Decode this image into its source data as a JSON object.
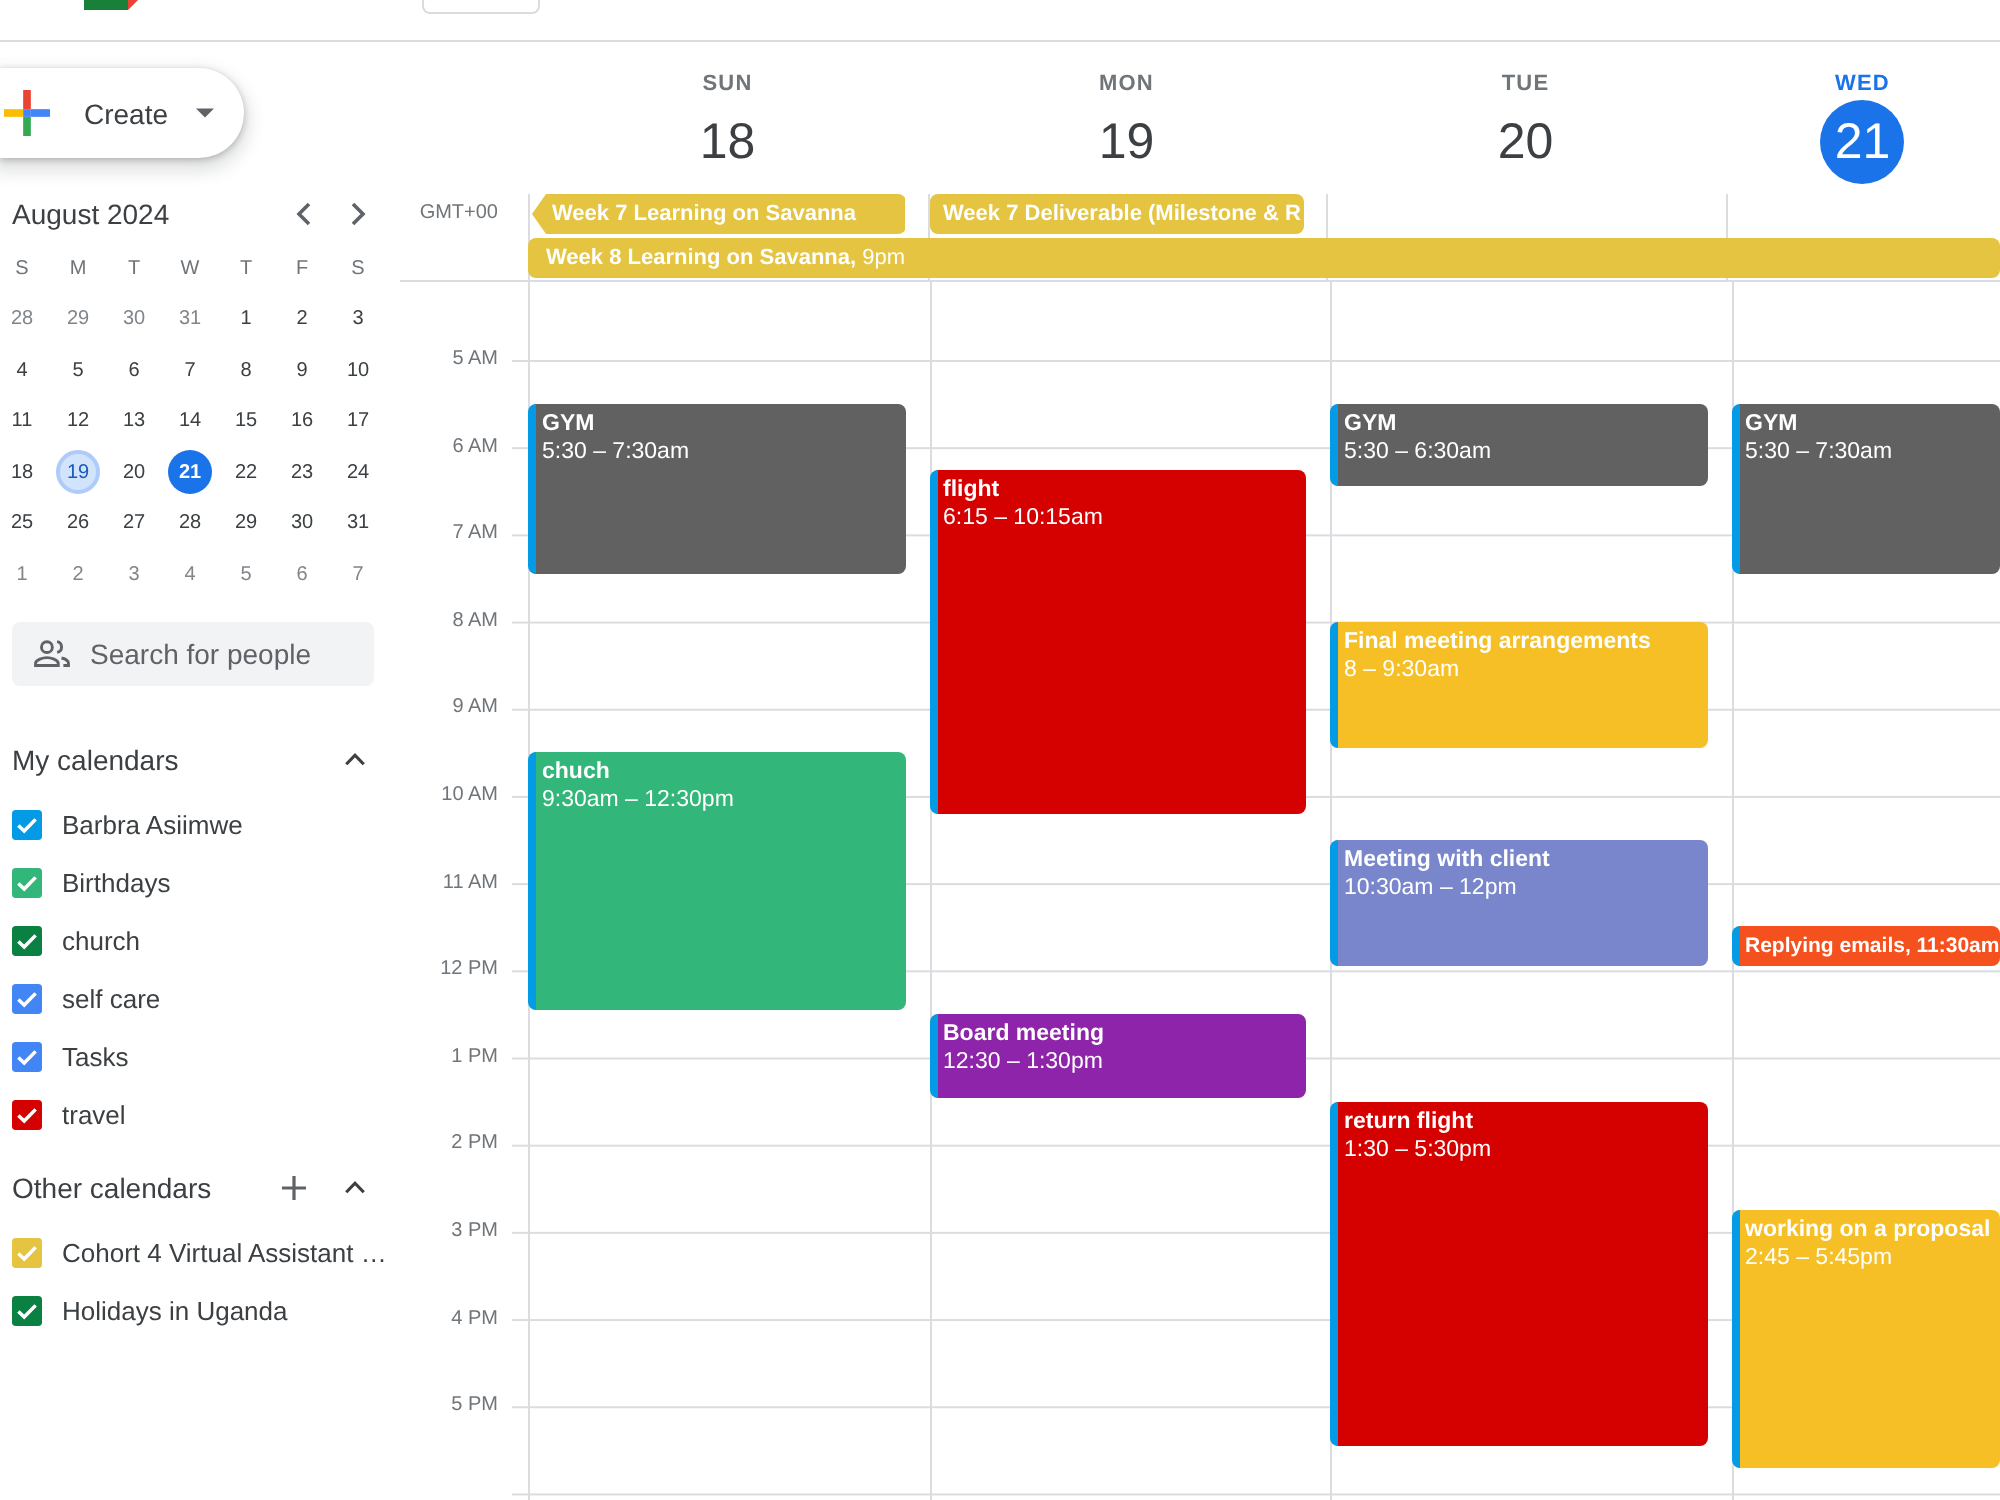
{
  "create_button": {
    "label": "Create"
  },
  "mini_calendar": {
    "title": "August 2024",
    "weekdays": [
      "S",
      "M",
      "T",
      "W",
      "T",
      "F",
      "S"
    ],
    "weeks": [
      [
        {
          "day": "28",
          "in_month": false,
          "selected": false,
          "today": false
        },
        {
          "day": "29",
          "in_month": false,
          "selected": false,
          "today": false
        },
        {
          "day": "30",
          "in_month": false,
          "selected": false,
          "today": false
        },
        {
          "day": "31",
          "in_month": false,
          "selected": false,
          "today": false
        },
        {
          "day": "1",
          "in_month": true,
          "selected": false,
          "today": false
        },
        {
          "day": "2",
          "in_month": true,
          "selected": false,
          "today": false
        },
        {
          "day": "3",
          "in_month": true,
          "selected": false,
          "today": false
        }
      ],
      [
        {
          "day": "4",
          "in_month": true,
          "selected": false,
          "today": false
        },
        {
          "day": "5",
          "in_month": true,
          "selected": false,
          "today": false
        },
        {
          "day": "6",
          "in_month": true,
          "selected": false,
          "today": false
        },
        {
          "day": "7",
          "in_month": true,
          "selected": false,
          "today": false
        },
        {
          "day": "8",
          "in_month": true,
          "selected": false,
          "today": false
        },
        {
          "day": "9",
          "in_month": true,
          "selected": false,
          "today": false
        },
        {
          "day": "10",
          "in_month": true,
          "selected": false,
          "today": false
        }
      ],
      [
        {
          "day": "11",
          "in_month": true,
          "selected": false,
          "today": false
        },
        {
          "day": "12",
          "in_month": true,
          "selected": false,
          "today": false
        },
        {
          "day": "13",
          "in_month": true,
          "selected": false,
          "today": false
        },
        {
          "day": "14",
          "in_month": true,
          "selected": false,
          "today": false
        },
        {
          "day": "15",
          "in_month": true,
          "selected": false,
          "today": false
        },
        {
          "day": "16",
          "in_month": true,
          "selected": false,
          "today": false
        },
        {
          "day": "17",
          "in_month": true,
          "selected": false,
          "today": false
        }
      ],
      [
        {
          "day": "18",
          "in_month": true,
          "selected": false,
          "today": false
        },
        {
          "day": "19",
          "in_month": true,
          "selected": true,
          "today": false
        },
        {
          "day": "20",
          "in_month": true,
          "selected": false,
          "today": false
        },
        {
          "day": "21",
          "in_month": true,
          "selected": false,
          "today": true
        },
        {
          "day": "22",
          "in_month": true,
          "selected": false,
          "today": false
        },
        {
          "day": "23",
          "in_month": true,
          "selected": false,
          "today": false
        },
        {
          "day": "24",
          "in_month": true,
          "selected": false,
          "today": false
        }
      ],
      [
        {
          "day": "25",
          "in_month": true,
          "selected": false,
          "today": false
        },
        {
          "day": "26",
          "in_month": true,
          "selected": false,
          "today": false
        },
        {
          "day": "27",
          "in_month": true,
          "selected": false,
          "today": false
        },
        {
          "day": "28",
          "in_month": true,
          "selected": false,
          "today": false
        },
        {
          "day": "29",
          "in_month": true,
          "selected": false,
          "today": false
        },
        {
          "day": "30",
          "in_month": true,
          "selected": false,
          "today": false
        },
        {
          "day": "31",
          "in_month": true,
          "selected": false,
          "today": false
        }
      ],
      [
        {
          "day": "1",
          "in_month": false,
          "selected": false,
          "today": false
        },
        {
          "day": "2",
          "in_month": false,
          "selected": false,
          "today": false
        },
        {
          "day": "3",
          "in_month": false,
          "selected": false,
          "today": false
        },
        {
          "day": "4",
          "in_month": false,
          "selected": false,
          "today": false
        },
        {
          "day": "5",
          "in_month": false,
          "selected": false,
          "today": false
        },
        {
          "day": "6",
          "in_month": false,
          "selected": false,
          "today": false
        },
        {
          "day": "7",
          "in_month": false,
          "selected": false,
          "today": false
        }
      ]
    ]
  },
  "people_search": {
    "placeholder": "Search for people"
  },
  "calendar_groups": [
    {
      "title": "My calendars",
      "expanded": true,
      "add_button": false,
      "items": [
        {
          "name": "Barbra Asiimwe",
          "color": "#039be5",
          "checked": true
        },
        {
          "name": "Birthdays",
          "color": "#33b679",
          "checked": true
        },
        {
          "name": "church",
          "color": "#0b8043",
          "checked": true
        },
        {
          "name": "self care",
          "color": "#4285f4",
          "checked": true
        },
        {
          "name": "Tasks",
          "color": "#4285f4",
          "checked": true
        },
        {
          "name": "travel",
          "color": "#d50000",
          "checked": true
        }
      ]
    },
    {
      "title": "Other calendars",
      "expanded": true,
      "add_button": true,
      "items": [
        {
          "name": "Cohort 4 Virtual Assistant …",
          "color": "#e4c441",
          "checked": true
        },
        {
          "name": "Holidays in Uganda",
          "color": "#0b8043",
          "checked": true
        }
      ]
    }
  ],
  "timezone": "GMT+00",
  "all_day_events": [
    {
      "title": "Week 7 Learning on Savanna",
      "continues_before": true
    },
    {
      "title": "Week 7 Deliverable (Milestone & R",
      "continues_before": false
    },
    {
      "title": "Week 8 Learning on Savanna,",
      "time": "9pm",
      "continues_before": false
    }
  ],
  "time_labels": [
    "5 AM",
    "6 AM",
    "7 AM",
    "8 AM",
    "9 AM",
    "10 AM",
    "11 AM",
    "12 PM",
    "1 PM",
    "2 PM",
    "3 PM",
    "4 PM",
    "5 PM"
  ],
  "days": [
    {
      "weekday": "SUN",
      "date": "18",
      "today": false,
      "events": [
        {
          "kind": "block",
          "title": "GYM",
          "time": "5:30 – 7:30am",
          "color": "#616161"
        },
        {
          "kind": "block",
          "title": "chuch",
          "time": "9:30am – 12:30pm",
          "color": "#33b679"
        }
      ]
    },
    {
      "weekday": "MON",
      "date": "19",
      "today": false,
      "events": [
        {
          "kind": "block",
          "title": "flight",
          "time": "6:15 – 10:15am",
          "color": "#d50000"
        },
        {
          "kind": "block",
          "title": "Board meeting",
          "time": "12:30 – 1:30pm",
          "color": "#8e24aa"
        }
      ]
    },
    {
      "weekday": "TUE",
      "date": "20",
      "today": false,
      "events": [
        {
          "kind": "block",
          "title": "GYM",
          "time": "5:30 – 6:30am",
          "color": "#616161"
        },
        {
          "kind": "block",
          "title": "Final meeting arrangements",
          "time": "8 – 9:30am",
          "color": "#f6bf26"
        },
        {
          "kind": "block",
          "title": "Meeting with client",
          "time": "10:30am – 12pm",
          "color": "#7986cb"
        },
        {
          "kind": "block",
          "title": "return flight",
          "time": "1:30 – 5:30pm",
          "color": "#d50000"
        }
      ]
    },
    {
      "weekday": "WED",
      "date": "21",
      "today": true,
      "events": [
        {
          "kind": "block",
          "title": "GYM",
          "time": "5:30 – 7:30am",
          "color": "#616161"
        },
        {
          "kind": "compact",
          "title": "Replying emails, 11:30am",
          "color": "#f4511e"
        },
        {
          "kind": "block",
          "title": "working on a proposal",
          "time": "2:45 – 5:45pm",
          "color": "#f6bf26"
        }
      ]
    }
  ]
}
